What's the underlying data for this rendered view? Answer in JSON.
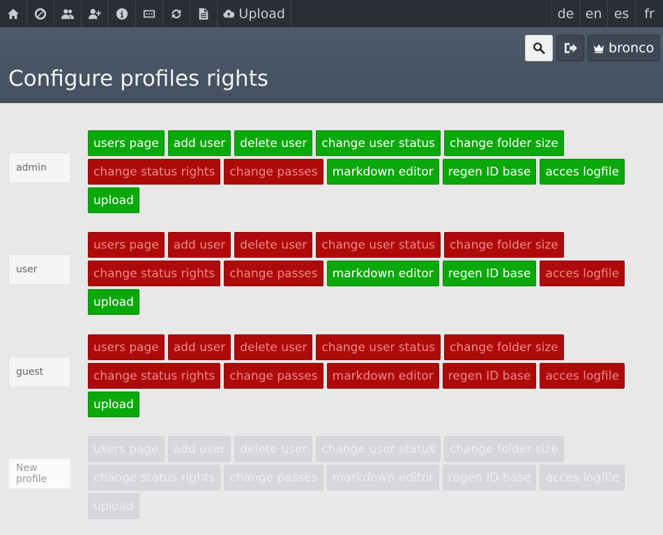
{
  "nav": {
    "icons": [
      "home-icon",
      "ban-icon",
      "users-icon",
      "add-user-icon",
      "info-icon",
      "password-icon",
      "refresh-icon",
      "document-icon"
    ],
    "upload_label": "Upload",
    "languages": [
      "de",
      "en",
      "es",
      "fr"
    ]
  },
  "header": {
    "user_label": "bronco",
    "title": "Configure profiles rights"
  },
  "colors": {
    "granted": "#0aa80a",
    "denied": "#ae0a0a",
    "inactive": "#d5d7db"
  },
  "profiles": [
    {
      "name": "admin",
      "rights": [
        {
          "label": "users page",
          "state": "on"
        },
        {
          "label": "add user",
          "state": "on"
        },
        {
          "label": "delete user",
          "state": "on"
        },
        {
          "label": "change user status",
          "state": "on"
        },
        {
          "label": "change folder size",
          "state": "on"
        },
        {
          "label": "change status rights",
          "state": "off"
        },
        {
          "label": "change passes",
          "state": "off"
        },
        {
          "label": "markdown editor",
          "state": "on"
        },
        {
          "label": "regen ID base",
          "state": "on"
        },
        {
          "label": "acces logfile",
          "state": "on"
        },
        {
          "label": "upload",
          "state": "on"
        }
      ]
    },
    {
      "name": "user",
      "rights": [
        {
          "label": "users page",
          "state": "off"
        },
        {
          "label": "add user",
          "state": "off"
        },
        {
          "label": "delete user",
          "state": "off"
        },
        {
          "label": "change user status",
          "state": "off"
        },
        {
          "label": "change folder size",
          "state": "off"
        },
        {
          "label": "change status rights",
          "state": "off"
        },
        {
          "label": "change passes",
          "state": "off"
        },
        {
          "label": "markdown editor",
          "state": "on"
        },
        {
          "label": "regen ID base",
          "state": "on"
        },
        {
          "label": "acces logfile",
          "state": "off"
        },
        {
          "label": "upload",
          "state": "on"
        }
      ]
    },
    {
      "name": "guest",
      "rights": [
        {
          "label": "users page",
          "state": "off"
        },
        {
          "label": "add user",
          "state": "off"
        },
        {
          "label": "delete user",
          "state": "off"
        },
        {
          "label": "change user status",
          "state": "off"
        },
        {
          "label": "change folder size",
          "state": "off"
        },
        {
          "label": "change status rights",
          "state": "off"
        },
        {
          "label": "change passes",
          "state": "off"
        },
        {
          "label": "markdown editor",
          "state": "off"
        },
        {
          "label": "regen ID base",
          "state": "off"
        },
        {
          "label": "acces logfile",
          "state": "off"
        },
        {
          "label": "upload",
          "state": "on"
        }
      ]
    },
    {
      "name": "",
      "placeholder": "New profile",
      "rights": [
        {
          "label": "users page",
          "state": "na"
        },
        {
          "label": "add user",
          "state": "na"
        },
        {
          "label": "delete user",
          "state": "na"
        },
        {
          "label": "change user status",
          "state": "na"
        },
        {
          "label": "change folder size",
          "state": "na"
        },
        {
          "label": "change status rights",
          "state": "na"
        },
        {
          "label": "change passes",
          "state": "na"
        },
        {
          "label": "markdown editor",
          "state": "na"
        },
        {
          "label": "regen ID base",
          "state": "na"
        },
        {
          "label": "acces logfile",
          "state": "na"
        },
        {
          "label": "upload",
          "state": "na"
        }
      ]
    }
  ]
}
